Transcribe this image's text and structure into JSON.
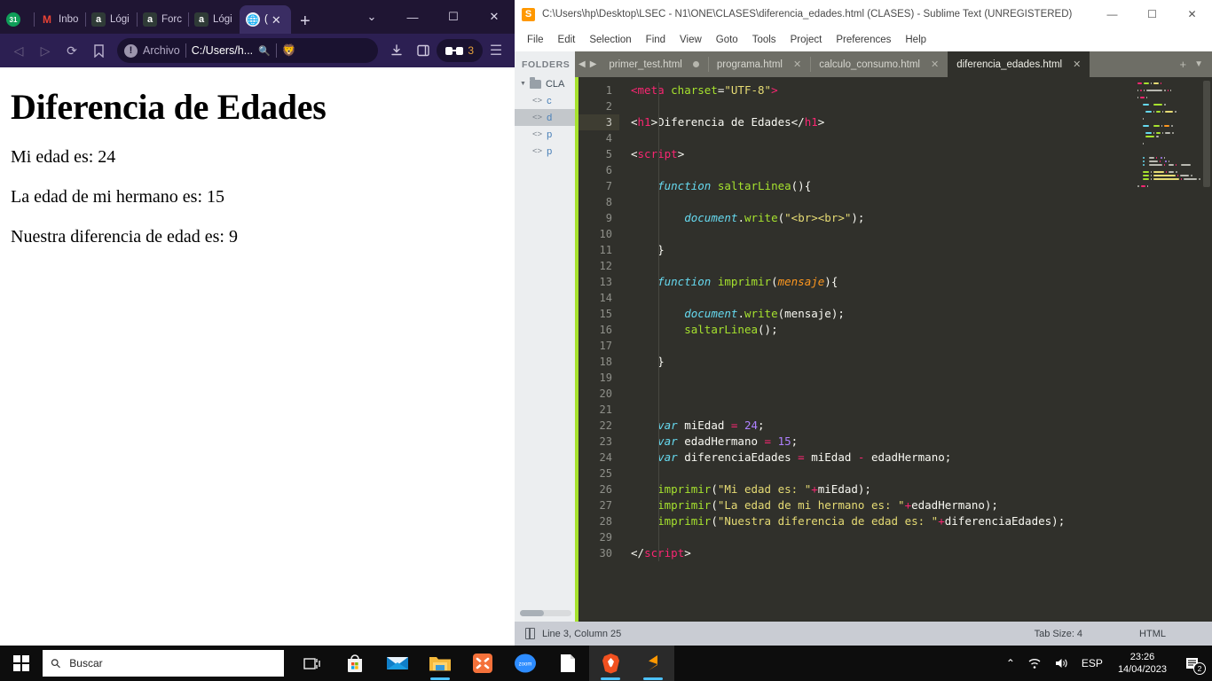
{
  "browser": {
    "tabs": [
      {
        "label": "",
        "icon": "calendar-31-icon",
        "active": false
      },
      {
        "label": "Inbo",
        "icon": "gmail-icon",
        "active": false
      },
      {
        "label": "Lógi",
        "icon": "alegra-a-icon",
        "active": false
      },
      {
        "label": "Forc",
        "icon": "alegra-a-icon",
        "active": false
      },
      {
        "label": "Lógi",
        "icon": "alegra-a-icon",
        "active": false
      },
      {
        "label": "(",
        "icon": "globe-icon",
        "active": true
      }
    ],
    "new_tab_label": "+",
    "window_controls": {
      "tab_search": "⌄",
      "minimize": "—",
      "maximize": "☐",
      "close": "✕"
    },
    "toolbar": {
      "back": "◁",
      "forward": "▷",
      "reload": "⟳",
      "bookmark": "🔖",
      "omnibox_scheme": "Archivo",
      "omnibox_url": "C:/Users/h...",
      "search_icon": "🔍",
      "brave_shields": "brave-lion-icon",
      "downloads": "download-icon",
      "sidebar": "panel-icon",
      "shields_count": "3",
      "menu": "☰"
    },
    "page": {
      "title": "Diferencia de Edades",
      "lines": [
        "Mi edad es: 24",
        "La edad de mi hermano es: 15",
        "Nuestra diferencia de edad es: 9"
      ]
    }
  },
  "sublime": {
    "title": "C:\\Users\\hp\\Desktop\\LSEC - N1\\ONE\\CLASES\\diferencia_edades.html (CLASES) - Sublime Text (UNREGISTERED)",
    "window_controls": {
      "minimize": "—",
      "maximize": "☐",
      "close": "✕"
    },
    "menu": [
      "File",
      "Edit",
      "Selection",
      "Find",
      "View",
      "Goto",
      "Tools",
      "Project",
      "Preferences",
      "Help"
    ],
    "sidebar": {
      "header": "FOLDERS",
      "folder": "CLA",
      "files": [
        "c",
        "d",
        "p",
        "p"
      ],
      "selected_index": 1
    },
    "tabs": [
      {
        "label": "primer_test.html",
        "close": "dot",
        "active": false
      },
      {
        "label": "programa.html",
        "close": "x",
        "active": false
      },
      {
        "label": "calculo_consumo.html",
        "close": "x",
        "active": false
      },
      {
        "label": "diferencia_edades.html",
        "close": "x",
        "active": true
      }
    ],
    "tab_controls": {
      "prev": "◀",
      "next": "▶",
      "add": "+",
      "list": "▼"
    },
    "code_lines": [
      {
        "n": 1,
        "tokens": [
          [
            "k-tag",
            "<meta "
          ],
          [
            "k-attr",
            "charset"
          ],
          [
            "k-punct",
            "="
          ],
          [
            "k-str",
            "\"UTF-8\""
          ],
          [
            "k-tag",
            ">"
          ]
        ]
      },
      {
        "n": 2,
        "tokens": []
      },
      {
        "n": 3,
        "tokens": [
          [
            "k-punct",
            "<"
          ],
          [
            "k-tag",
            "h1"
          ],
          [
            "k-punct",
            ">"
          ],
          [
            "k-plain",
            "Diferencia de Edades"
          ],
          [
            "k-punct",
            "</"
          ],
          [
            "k-tag",
            "h1"
          ],
          [
            "k-punct",
            ">"
          ]
        ],
        "current": true
      },
      {
        "n": 4,
        "tokens": []
      },
      {
        "n": 5,
        "tokens": [
          [
            "k-punct",
            "<"
          ],
          [
            "k-tag",
            "script"
          ],
          [
            "k-punct",
            ">"
          ]
        ]
      },
      {
        "n": 6,
        "tokens": []
      },
      {
        "n": 7,
        "tokens": [
          [
            "k-plain",
            "    "
          ],
          [
            "k-kw",
            "function"
          ],
          [
            "k-plain",
            " "
          ],
          [
            "k-fn",
            "saltarLinea"
          ],
          [
            "k-punct",
            "(){"
          ]
        ]
      },
      {
        "n": 8,
        "tokens": []
      },
      {
        "n": 9,
        "tokens": [
          [
            "k-plain",
            "        "
          ],
          [
            "k-obj",
            "document"
          ],
          [
            "k-punct",
            "."
          ],
          [
            "k-fn",
            "write"
          ],
          [
            "k-punct",
            "("
          ],
          [
            "k-str",
            "\"<br><br>\""
          ],
          [
            "k-punct",
            ");"
          ]
        ]
      },
      {
        "n": 10,
        "tokens": []
      },
      {
        "n": 11,
        "tokens": [
          [
            "k-punct",
            "    }"
          ]
        ]
      },
      {
        "n": 12,
        "tokens": []
      },
      {
        "n": 13,
        "tokens": [
          [
            "k-plain",
            "    "
          ],
          [
            "k-kw",
            "function"
          ],
          [
            "k-plain",
            " "
          ],
          [
            "k-fn",
            "imprimir"
          ],
          [
            "k-punct",
            "("
          ],
          [
            "k-param",
            "mensaje"
          ],
          [
            "k-punct",
            "){"
          ]
        ]
      },
      {
        "n": 14,
        "tokens": []
      },
      {
        "n": 15,
        "tokens": [
          [
            "k-plain",
            "        "
          ],
          [
            "k-obj",
            "document"
          ],
          [
            "k-punct",
            "."
          ],
          [
            "k-fn",
            "write"
          ],
          [
            "k-punct",
            "("
          ],
          [
            "k-plain",
            "mensaje"
          ],
          [
            "k-punct",
            ");"
          ]
        ]
      },
      {
        "n": 16,
        "tokens": [
          [
            "k-plain",
            "        "
          ],
          [
            "k-fn",
            "saltarLinea"
          ],
          [
            "k-punct",
            "();"
          ]
        ]
      },
      {
        "n": 17,
        "tokens": []
      },
      {
        "n": 18,
        "tokens": [
          [
            "k-punct",
            "    }"
          ]
        ]
      },
      {
        "n": 19,
        "tokens": []
      },
      {
        "n": 20,
        "tokens": []
      },
      {
        "n": 21,
        "tokens": []
      },
      {
        "n": 22,
        "tokens": [
          [
            "k-plain",
            "    "
          ],
          [
            "k-kw",
            "var"
          ],
          [
            "k-plain",
            " miEdad "
          ],
          [
            "k-op",
            "="
          ],
          [
            "k-plain",
            " "
          ],
          [
            "k-num",
            "24"
          ],
          [
            "k-punct",
            ";"
          ]
        ]
      },
      {
        "n": 23,
        "tokens": [
          [
            "k-plain",
            "    "
          ],
          [
            "k-kw",
            "var"
          ],
          [
            "k-plain",
            " edadHermano "
          ],
          [
            "k-op",
            "="
          ],
          [
            "k-plain",
            " "
          ],
          [
            "k-num",
            "15"
          ],
          [
            "k-punct",
            ";"
          ]
        ]
      },
      {
        "n": 24,
        "tokens": [
          [
            "k-plain",
            "    "
          ],
          [
            "k-kw",
            "var"
          ],
          [
            "k-plain",
            " diferenciaEdades "
          ],
          [
            "k-op",
            "="
          ],
          [
            "k-plain",
            " miEdad "
          ],
          [
            "k-op",
            "-"
          ],
          [
            "k-plain",
            " edadHermano;"
          ]
        ]
      },
      {
        "n": 25,
        "tokens": []
      },
      {
        "n": 26,
        "tokens": [
          [
            "k-plain",
            "    "
          ],
          [
            "k-fn",
            "imprimir"
          ],
          [
            "k-punct",
            "("
          ],
          [
            "k-str",
            "\"Mi edad es: \""
          ],
          [
            "k-op",
            "+"
          ],
          [
            "k-plain",
            "miEdad"
          ],
          [
            "k-punct",
            ");"
          ]
        ]
      },
      {
        "n": 27,
        "tokens": [
          [
            "k-plain",
            "    "
          ],
          [
            "k-fn",
            "imprimir"
          ],
          [
            "k-punct",
            "("
          ],
          [
            "k-str",
            "\"La edad de mi hermano es: \""
          ],
          [
            "k-op",
            "+"
          ],
          [
            "k-plain",
            "edadHermano"
          ],
          [
            "k-punct",
            ");"
          ]
        ]
      },
      {
        "n": 28,
        "tokens": [
          [
            "k-plain",
            "    "
          ],
          [
            "k-fn",
            "imprimir"
          ],
          [
            "k-punct",
            "("
          ],
          [
            "k-str",
            "\"Nuestra diferencia de edad es: \""
          ],
          [
            "k-op",
            "+"
          ],
          [
            "k-plain",
            "diferenciaEdades"
          ],
          [
            "k-punct",
            ");"
          ]
        ]
      },
      {
        "n": 29,
        "tokens": []
      },
      {
        "n": 30,
        "tokens": [
          [
            "k-punct",
            "</"
          ],
          [
            "k-tag",
            "script"
          ],
          [
            "k-punct",
            ">"
          ]
        ]
      }
    ],
    "status": {
      "cursor": "Line 3, Column 25",
      "tab_size": "Tab Size: 4",
      "syntax": "HTML"
    }
  },
  "taskbar": {
    "start_label": "start-icon",
    "search_placeholder": "Buscar",
    "icons": [
      "task-view-icon",
      "microsoft-store-icon",
      "mail-icon",
      "file-explorer-icon",
      "xampp-icon",
      "zoom-icon",
      "notepad-icon",
      "brave-icon",
      "sublime-text-icon"
    ],
    "tray": {
      "chevron": "⌃",
      "network": "network-icon",
      "volume": "volume-icon",
      "language": "ESP",
      "time": "23:26",
      "date": "14/04/2023",
      "notification_count": "2"
    }
  }
}
